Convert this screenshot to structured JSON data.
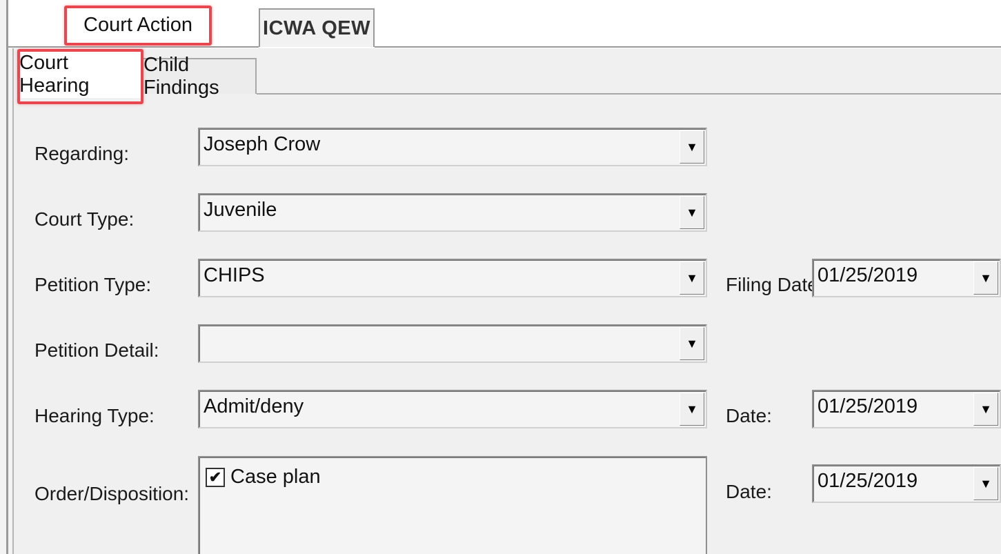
{
  "tabs": {
    "outer": [
      "Court Action",
      "ICWA QEW"
    ],
    "inner": [
      "Court Hearing",
      "Child Findings"
    ]
  },
  "form": {
    "regarding": {
      "label": "Regarding:",
      "value": "Joseph Crow"
    },
    "court_type": {
      "label": "Court Type:",
      "value": "Juvenile"
    },
    "petition_type": {
      "label": "Petition Type:",
      "value": "CHIPS"
    },
    "filing_date": {
      "label": "Filing Date:",
      "value": "01/25/2019"
    },
    "petition_detail": {
      "label": "Petition Detail:",
      "value": ""
    },
    "hearing_type": {
      "label": "Hearing Type:",
      "value": "Admit/deny"
    },
    "hearing_date": {
      "label": "Date:",
      "value": "01/25/2019"
    },
    "order_disposition": {
      "label": "Order/Disposition:",
      "items": [
        {
          "label": "Case plan",
          "checked": true
        }
      ]
    },
    "order_date": {
      "label": "Date:",
      "value": "01/25/2019"
    }
  },
  "icons": {
    "dropdown": "chevron-down-icon",
    "checkbox": "checkmark-icon"
  },
  "colors": {
    "highlight": "#e8474f",
    "panel_background": "#f0f0f0",
    "field_background": "#f4f4f4"
  }
}
